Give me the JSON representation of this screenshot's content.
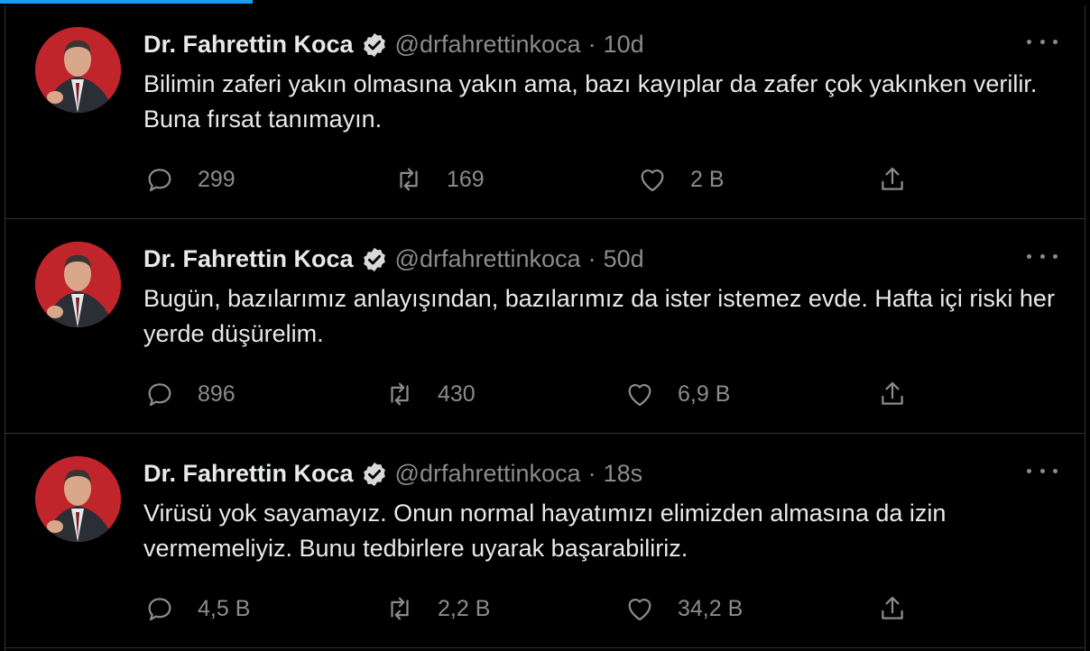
{
  "tweets": [
    {
      "name": "Dr. Fahrettin Koca",
      "handle": "@drfahrettinkoca",
      "separator": "·",
      "time": "10d",
      "text": "Bilimin zaferi yakın olmasına yakın ama, bazı kayıplar da zafer çok yakınken verilir. Buna fırsat tanımayın.",
      "replies": "299",
      "retweets": "169",
      "likes": "2 B"
    },
    {
      "name": "Dr. Fahrettin Koca",
      "handle": "@drfahrettinkoca",
      "separator": "·",
      "time": "50d",
      "text": "Bugün, bazılarımız anlayışından, bazılarımız da ister istemez evde. Hafta içi riski her yerde düşürelim.",
      "replies": "896",
      "retweets": "430",
      "likes": "6,9 B"
    },
    {
      "name": "Dr. Fahrettin Koca",
      "handle": "@drfahrettinkoca",
      "separator": "·",
      "time": "18s",
      "text": "Virüsü yok sayamayız. Onun normal hayatımızı elimizden almasına da izin vermemeliyiz. Bunu tedbirlere uyarak başarabiliriz.",
      "replies": "4,5 B",
      "retweets": "2,2 B",
      "likes": "34,2 B"
    }
  ],
  "icons": {
    "reply": "reply-icon",
    "retweet": "retweet-icon",
    "like": "like-icon",
    "share": "share-icon",
    "more": "more-icon",
    "verified": "verified-badge-icon"
  },
  "colors": {
    "background": "#000000",
    "accent": "#1d9bf0",
    "muted": "#8b8b8b",
    "border": "#2f3336"
  }
}
